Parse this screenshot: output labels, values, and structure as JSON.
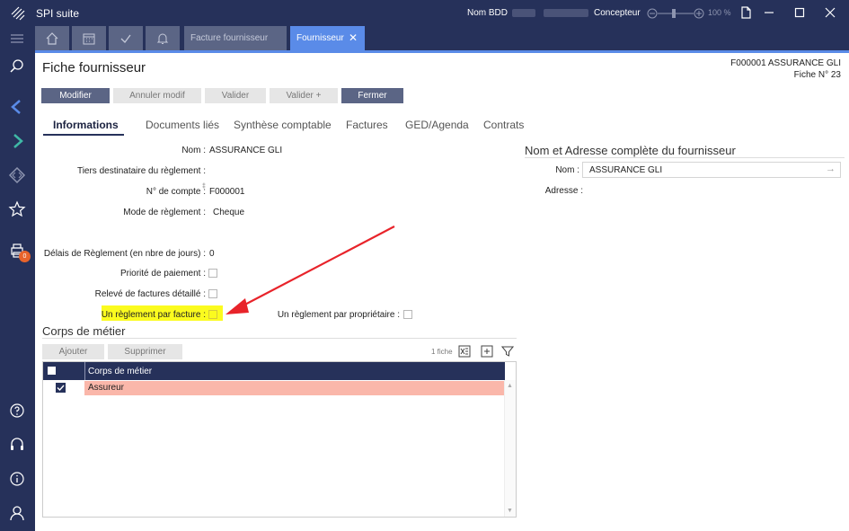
{
  "app": {
    "title": "SPI suite",
    "db_label": "Nom BDD",
    "role": "Concepteur",
    "zoom_level": "100 %"
  },
  "tabs": {
    "doc_tabs": [
      {
        "label": "Facture fournisseur"
      },
      {
        "label": "Fournisseur"
      }
    ]
  },
  "sidebar": {
    "icons": [
      "menu-icon",
      "search-icon",
      "arrow-left-icon",
      "arrow-right-icon",
      "diamond-icon",
      "star-icon",
      "printer-icon",
      "help-icon",
      "headset-icon",
      "info-icon",
      "user-icon"
    ],
    "badge": "0"
  },
  "page": {
    "title": "Fiche fournisseur",
    "ref": "F000001 ASSURANCE GLI",
    "fiche": "Fiche N° 23"
  },
  "toolbar": {
    "modifier": "Modifier",
    "annuler": "Annuler modif",
    "valider": "Valider",
    "valider_plus": "Valider +",
    "fermer": "Fermer"
  },
  "content_tabs": [
    "Informations",
    "Documents liés",
    "Synthèse comptable",
    "Factures",
    "GED/Agenda",
    "Contrats"
  ],
  "form": {
    "nom_label": "Nom :",
    "nom_value": "ASSURANCE GLI",
    "tiers_label": "Tiers destinataire du règlement :",
    "compte_label": "N° de compte :",
    "compte_value": "F000001",
    "mode_label": "Mode de règlement :",
    "mode_value": "Cheque",
    "delais_label": "Délais de Règlement (en nbre de jours) :",
    "delais_value": "0",
    "priorite_label": "Priorité de paiement :",
    "releve_label": "Relevé de factures détaillé :",
    "reglement_facture_label": "Un règlement par facture :",
    "reglement_proprio_label": "Un règlement par propriétaire :"
  },
  "address": {
    "title": "Nom et Adresse complète du fournisseur",
    "nom_label": "Nom :",
    "nom_value": "ASSURANCE GLI",
    "adresse_label": "Adresse :"
  },
  "corps": {
    "title": "Corps de métier",
    "ajouter": "Ajouter",
    "supprimer": "Supprimer",
    "count": "1 fiche",
    "column": "Corps de métier",
    "rows": [
      {
        "value": "Assureur",
        "checked": true
      }
    ]
  },
  "colors": {
    "navy": "#26315a",
    "accent": "#5a8be8",
    "highlight": "#fbfb1f",
    "row_selected": "#fab7aa",
    "annotation_arrow": "#e8232a"
  }
}
